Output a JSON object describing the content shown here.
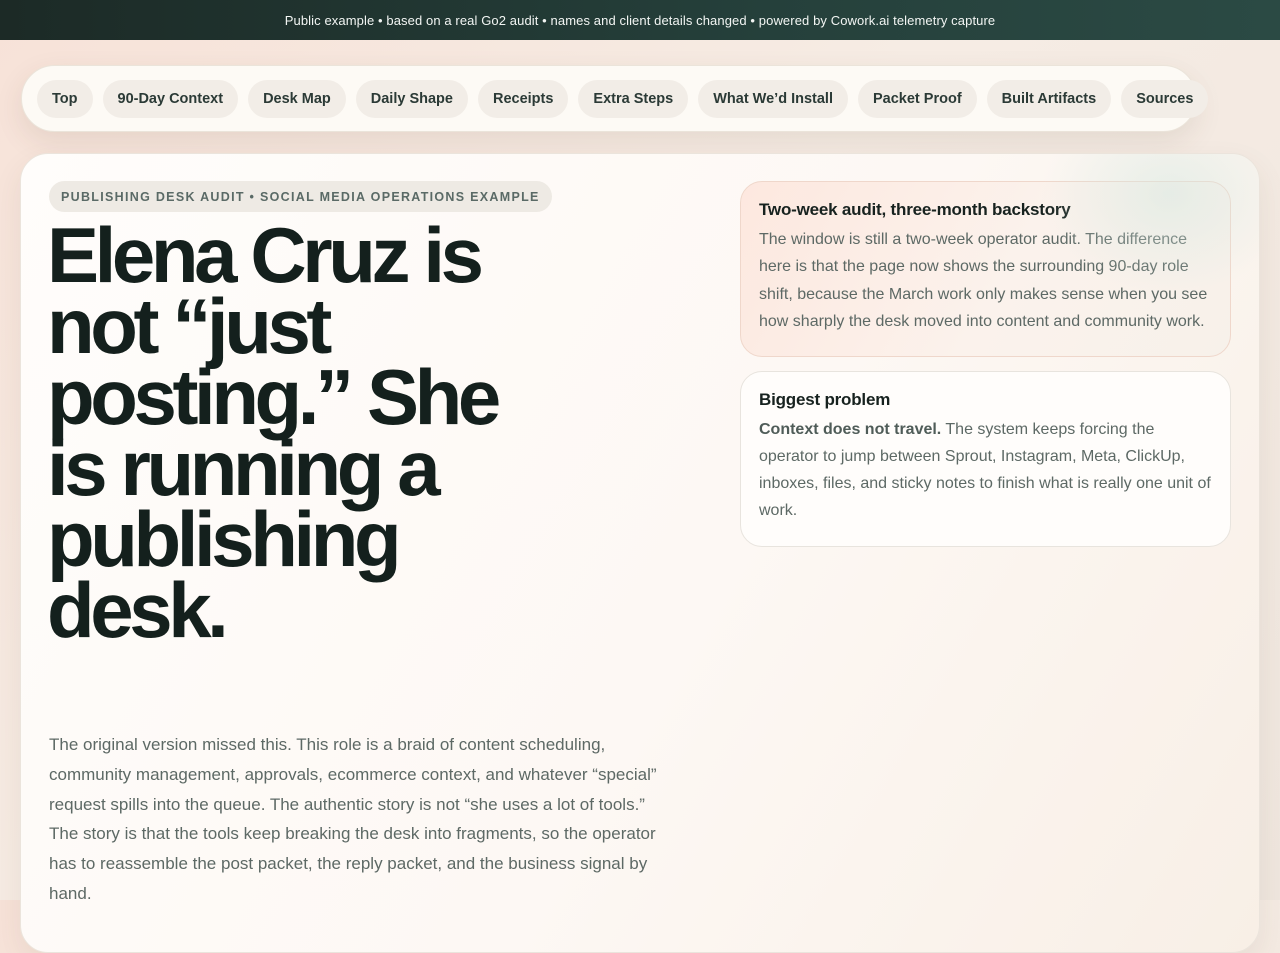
{
  "banner": {
    "text": "Public example • based on a real Go2 audit • names and client details changed • powered by Cowork.ai telemetry capture"
  },
  "nav": {
    "items": [
      {
        "label": "Top"
      },
      {
        "label": "90-Day Context"
      },
      {
        "label": "Desk Map"
      },
      {
        "label": "Daily Shape"
      },
      {
        "label": "Receipts"
      },
      {
        "label": "Extra Steps"
      },
      {
        "label": "What We’d Install"
      },
      {
        "label": "Packet Proof"
      },
      {
        "label": "Built Artifacts"
      },
      {
        "label": "Sources"
      }
    ]
  },
  "hero": {
    "eyebrow": "PUBLISHING DESK AUDIT • SOCIAL MEDIA OPERATIONS EXAMPLE",
    "headline": "Elena Cruz is not “just posting.” She is running a publishing desk.",
    "lede": "The original version missed this. This role is a braid of content scheduling, community management, approvals, ecommerce context, and whatever “special” request spills into the queue. The authentic story is not “she uses a lot of tools.” The story is that the tools keep breaking the desk into fragments, so the operator has to reassemble the post packet, the reply packet, and the business signal by hand."
  },
  "notes": {
    "context": {
      "title": "Two-week audit, three-month backstory",
      "body": "The window is still a two-week operator audit. The difference here is that the page now shows the surrounding 90-day role shift, because the March work only makes sense when you see how sharply the desk moved into content and community work."
    },
    "problem": {
      "title": "Biggest problem",
      "lead": "Context does not travel.",
      "body": " The system keeps forcing the operator to jump between Sprout, Instagram, Meta, ClickUp, inboxes, files, and sticky notes to finish what is really one unit of work."
    }
  }
}
